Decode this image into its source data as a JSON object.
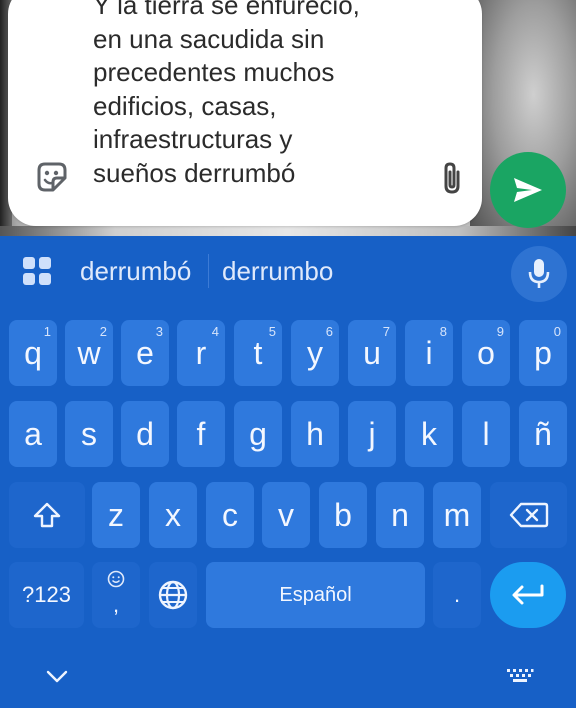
{
  "compose": {
    "text": "Y la tierra se enfureció,\nen una sacudida sin\nprecedentes muchos\nedificios, casas,\ninfraestructuras y\nsueños derrumbó",
    "icons": [
      "sticker-icon",
      "attachment-icon"
    ]
  },
  "send": {
    "icon": "send-arrow-icon",
    "color": "#1aa563"
  },
  "suggestions": {
    "items": [
      "derrumbó",
      "derrumbo"
    ],
    "icons": [
      "apps-grid-icon",
      "microphone-icon"
    ]
  },
  "keyboard": {
    "row1": [
      {
        "label": "q",
        "hint": "1"
      },
      {
        "label": "w",
        "hint": "2"
      },
      {
        "label": "e",
        "hint": "3"
      },
      {
        "label": "r",
        "hint": "4"
      },
      {
        "label": "t",
        "hint": "5"
      },
      {
        "label": "y",
        "hint": "6"
      },
      {
        "label": "u",
        "hint": "7"
      },
      {
        "label": "i",
        "hint": "8"
      },
      {
        "label": "o",
        "hint": "9"
      },
      {
        "label": "p",
        "hint": "0"
      }
    ],
    "row2": [
      "a",
      "s",
      "d",
      "f",
      "g",
      "h",
      "j",
      "k",
      "l",
      "ñ"
    ],
    "row3": [
      "z",
      "x",
      "c",
      "v",
      "b",
      "n",
      "m"
    ],
    "row3_icons": [
      "shift-icon",
      "backspace-icon"
    ],
    "symbols_label": "?123",
    "emoji_comma_label": ",",
    "space_label": "Español",
    "period_label": ".",
    "bottom_icons": [
      "emoji-icon",
      "globe-icon",
      "enter-icon"
    ],
    "nav_icons": [
      "chevron-down-icon",
      "keyboard-switch-icon"
    ],
    "colors": {
      "background": "#1760c6",
      "key": "#2f79dd",
      "special_key": "#1e66cc",
      "enter": "#1b9cf0"
    }
  }
}
